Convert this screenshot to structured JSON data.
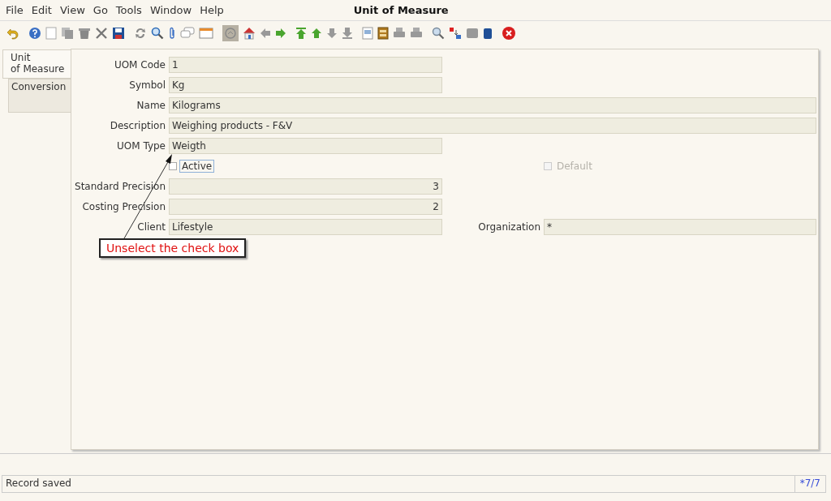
{
  "window": {
    "title": "Unit of Measure"
  },
  "menu": [
    "File",
    "Edit",
    "View",
    "Go",
    "Tools",
    "Window",
    "Help"
  ],
  "tabs": [
    {
      "lines": [
        "Unit",
        "of Measure"
      ],
      "selected": true
    },
    {
      "lines": [
        "Conversion"
      ],
      "selected": false
    }
  ],
  "form": {
    "rows": [
      {
        "fields": [
          {
            "kind": "text",
            "label": "UOM Code",
            "value": "1"
          }
        ]
      },
      {
        "fields": [
          {
            "kind": "text",
            "label": "Symbol",
            "value": "Kg"
          }
        ]
      },
      {
        "fields": [
          {
            "kind": "text",
            "label": "Name",
            "value": "Kilograms"
          }
        ]
      },
      {
        "fields": [
          {
            "kind": "text",
            "label": "Description",
            "value": "Weighing products - F&V"
          }
        ]
      },
      {
        "fields": [
          {
            "kind": "text",
            "label": "UOM Type",
            "value": "Weigth"
          }
        ]
      },
      {
        "fields": [
          {
            "kind": "checkbox",
            "label": "Active",
            "checked": false,
            "disabled": false,
            "focused": true
          },
          {
            "kind": "checkbox",
            "label": "Default",
            "checked": false,
            "disabled": true,
            "focused": false
          }
        ]
      },
      {
        "fields": [
          {
            "kind": "number",
            "label": "Standard Precision",
            "value": "3"
          }
        ]
      },
      {
        "fields": [
          {
            "kind": "number",
            "label": "Costing Precision",
            "value": "2"
          }
        ]
      },
      {
        "fields": [
          {
            "kind": "text",
            "label": "Client",
            "value": "Lifestyle"
          },
          {
            "kind": "text",
            "label": "Organization",
            "value": "*"
          }
        ]
      }
    ]
  },
  "callout": {
    "text": "Unselect the check box"
  },
  "status_bar": {
    "message": "Record saved",
    "record": "*7/7"
  }
}
